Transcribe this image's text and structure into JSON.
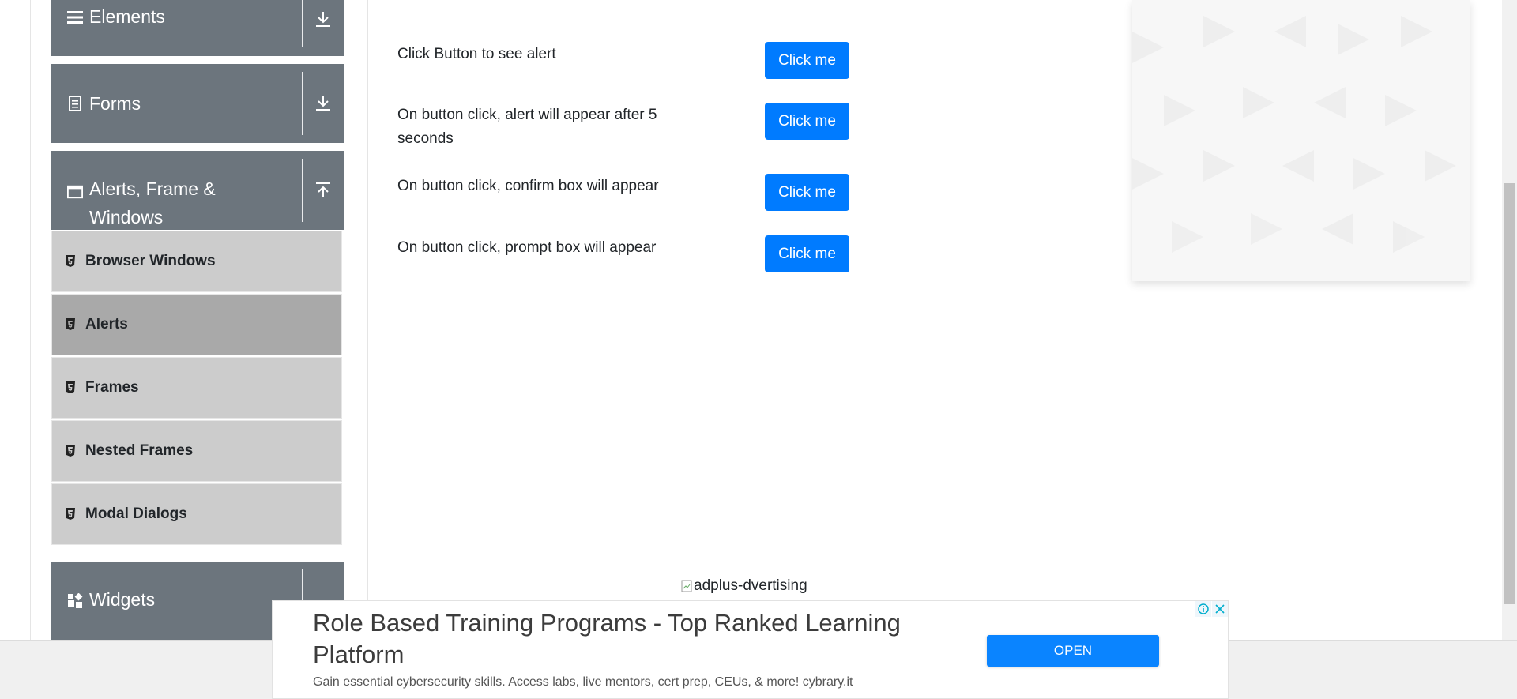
{
  "sidebar": {
    "groups": [
      {
        "title": "Elements",
        "icon": "list-icon",
        "toggle": "download-icon"
      },
      {
        "title": "Forms",
        "icon": "document-icon",
        "toggle": "download-icon"
      },
      {
        "title": "Alerts, Frame & Windows",
        "icon": "browser-window-icon",
        "toggle": "upload-icon"
      },
      {
        "title": "Widgets",
        "icon": "widgets-icon",
        "toggle": "download-icon"
      }
    ],
    "items": [
      {
        "label": "Browser Windows",
        "active": false
      },
      {
        "label": "Alerts",
        "active": true
      },
      {
        "label": "Frames",
        "active": false
      },
      {
        "label": "Nested Frames",
        "active": false
      },
      {
        "label": "Modal Dialogs",
        "active": false
      }
    ]
  },
  "main": {
    "rows": [
      {
        "text": "Click Button to see alert",
        "button": "Click me"
      },
      {
        "text": "On button click, alert will appear after 5 seconds",
        "button": "Click me"
      },
      {
        "text": "On button click, confirm box will appear",
        "button": "Click me"
      },
      {
        "text": "On button click, prompt box will appear",
        "button": "Click me"
      }
    ]
  },
  "ad": {
    "alt_text": "adplus-dvertising",
    "headline": "Role Based Training Programs - Top Ranked Learning Platform",
    "description": "Gain essential cybersecurity skills. Access labs, live mentors, cert prep, CEUs, & more! cybrary.it",
    "cta": "OPEN"
  },
  "colors": {
    "sidebar_header": "#6c757d",
    "sidebar_item": "#cccccc",
    "sidebar_item_active": "#a9a9a9",
    "primary_button": "#007bff"
  }
}
